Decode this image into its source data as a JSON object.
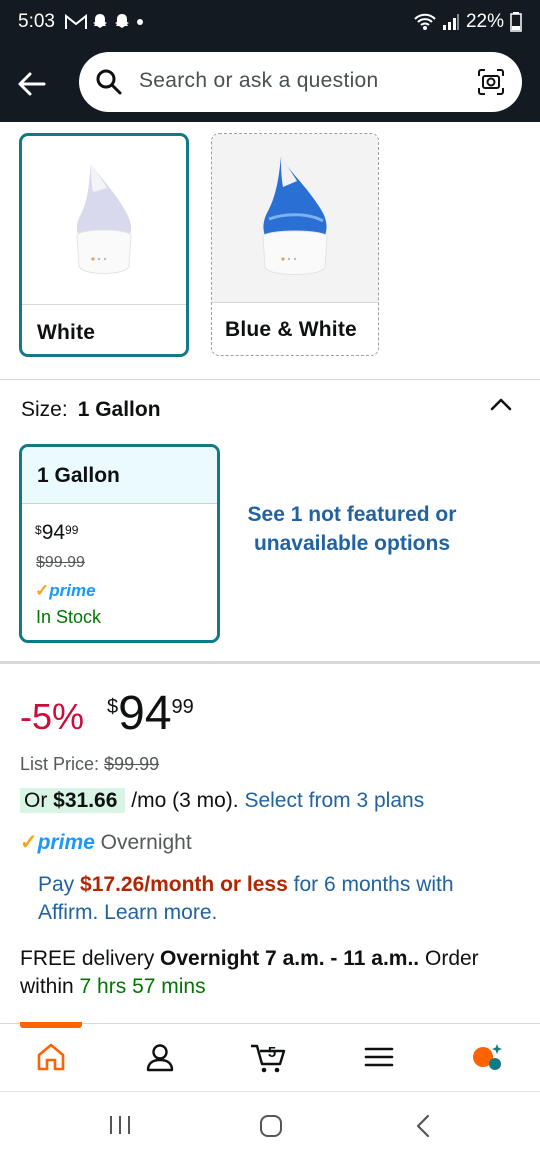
{
  "status_bar": {
    "time": "5:03",
    "battery": "22%"
  },
  "search": {
    "placeholder": "Search or ask a question"
  },
  "color_options": [
    {
      "label": "White",
      "selected": true
    },
    {
      "label": "Blue & White",
      "selected": false
    }
  ],
  "size": {
    "label": "Size:",
    "value": "1 Gallon"
  },
  "size_card": {
    "title": "1 Gallon",
    "currency": "$",
    "price_whole": "94",
    "price_fraction": "99",
    "list_price": "$99.99",
    "prime_label": "prime",
    "stock": "In Stock"
  },
  "see_more": "See 1 not featured or unavailable options",
  "pricing": {
    "discount": "-5%",
    "currency": "$",
    "whole": "94",
    "fraction": "99",
    "list_price_label": "List Price:",
    "list_price": "$99.99",
    "plan_prefix": "Or",
    "plan_amount": "$31.66",
    "plan_term": "/mo (3 mo).",
    "plan_link": "Select from 3 plans"
  },
  "prime_delivery": {
    "prime": "prime",
    "speed": "Overnight"
  },
  "affirm": {
    "pay": "Pay",
    "amount": "$17.26/month or less",
    "rest": "for 6 months with Affirm.",
    "link": "Learn more."
  },
  "delivery": {
    "prefix": "FREE delivery",
    "window": "Overnight 7 a.m. - 11 a.m..",
    "order_within": "Order within",
    "countdown": "7 hrs 57 mins"
  },
  "bottom_nav": {
    "cart_count": "5",
    "accent": "#ff6200"
  },
  "colors": {
    "header_bg": "#131a22",
    "selected_border": "#127a85",
    "link": "#2162a1",
    "discount_red": "#cc0c39",
    "stock_green": "#007600"
  }
}
